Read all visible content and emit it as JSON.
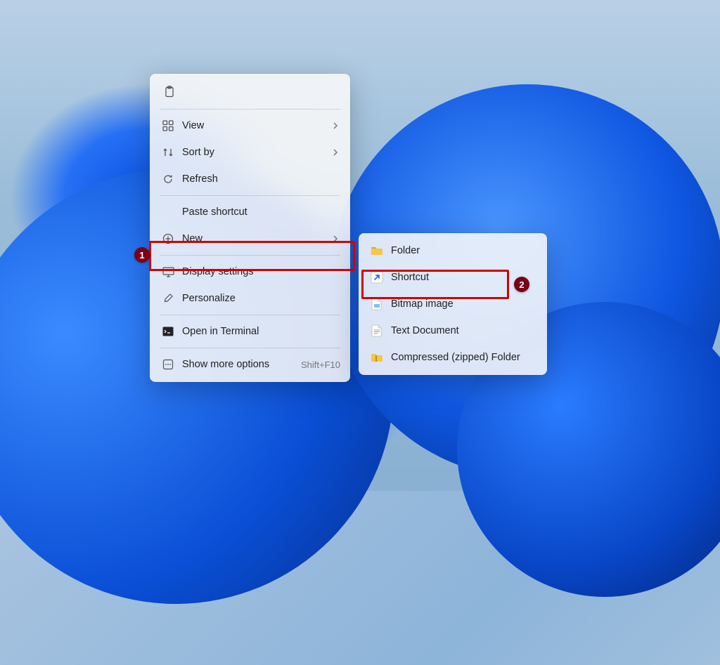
{
  "annotations": {
    "badge1": "1",
    "badge2": "2"
  },
  "main_menu": {
    "view": "View",
    "sort_by": "Sort by",
    "refresh": "Refresh",
    "paste_shortcut": "Paste shortcut",
    "new": "New",
    "display_settings": "Display settings",
    "personalize": "Personalize",
    "open_in_terminal": "Open in Terminal",
    "show_more_options": "Show more options",
    "show_more_accel": "Shift+F10"
  },
  "sub_menu": {
    "folder": "Folder",
    "shortcut": "Shortcut",
    "bitmap": "Bitmap image",
    "text_doc": "Text Document",
    "zipped": "Compressed (zipped) Folder"
  }
}
